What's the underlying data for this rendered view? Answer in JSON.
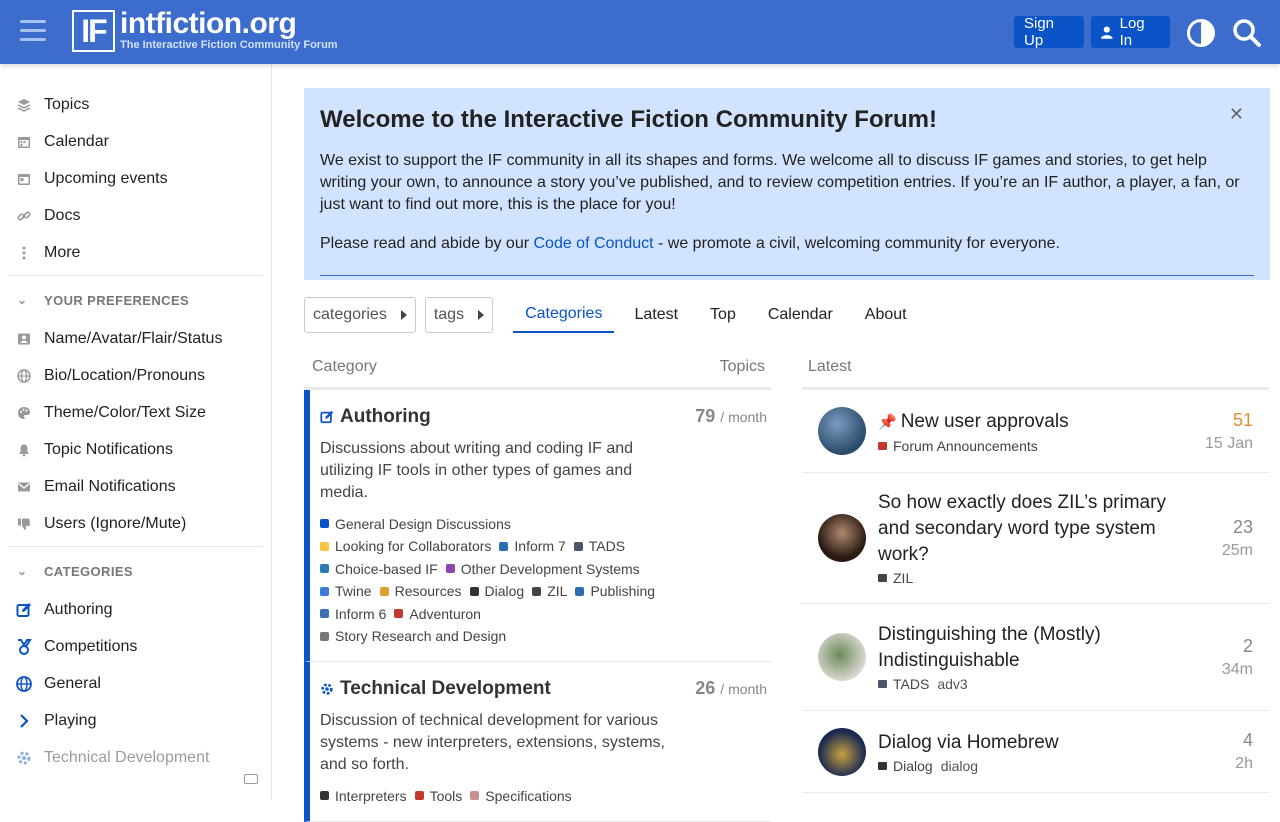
{
  "header": {
    "logo_mark": "IF",
    "logo_title": "intfiction.org",
    "logo_subtitle": "The Interactive Fiction Community Forum",
    "signup_label": "Sign Up",
    "login_label": "Log In"
  },
  "sidebar": {
    "top_items": [
      {
        "label": "Topics",
        "icon": "layers-icon"
      },
      {
        "label": "Calendar",
        "icon": "calendar-icon"
      },
      {
        "label": "Upcoming events",
        "icon": "calendar-day-icon"
      },
      {
        "label": "Docs",
        "icon": "link-icon"
      },
      {
        "label": "More",
        "icon": "ellipsis-icon"
      }
    ],
    "prefs_header": "YOUR PREFERENCES",
    "prefs_items": [
      {
        "label": "Name/Avatar/Flair/Status",
        "icon": "id-card-icon"
      },
      {
        "label": "Bio/Location/Pronouns",
        "icon": "globe-icon"
      },
      {
        "label": "Theme/Color/Text Size",
        "icon": "palette-icon"
      },
      {
        "label": "Topic Notifications",
        "icon": "bell-icon"
      },
      {
        "label": "Email Notifications",
        "icon": "envelope-icon"
      },
      {
        "label": "Users (Ignore/Mute)",
        "icon": "thumbs-down-icon"
      }
    ],
    "categories_header": "CATEGORIES",
    "category_items": [
      {
        "label": "Authoring",
        "icon": "edit-icon"
      },
      {
        "label": "Competitions",
        "icon": "medal-icon"
      },
      {
        "label": "General",
        "icon": "globe-icon"
      },
      {
        "label": "Playing",
        "icon": "chevron-right-icon"
      },
      {
        "label": "Technical Development",
        "icon": "gear-icon"
      }
    ]
  },
  "banner": {
    "title": "Welcome to the Interactive Fiction Community Forum!",
    "paragraph": "We exist to support the IF community in all its shapes and forms. We welcome all to discuss IF games and stories, to get help writing your own, to announce a story you’ve published, and to review competition entries. If you’re an IF author, a player, a fan, or just want to find out more, this is the place for you!",
    "conduct_prefix": "Please read and abide by our ",
    "conduct_link": "Code of Conduct",
    "conduct_suffix": " - we promote a civil, welcoming community for everyone."
  },
  "nav": {
    "categories_dropdown": "categories",
    "tags_dropdown": "tags",
    "tabs": [
      "Categories",
      "Latest",
      "Top",
      "Calendar",
      "About"
    ],
    "active_tab": "Categories"
  },
  "categories_table": {
    "col_category": "Category",
    "col_topics": "Topics",
    "rows": [
      {
        "name": "Authoring",
        "count": "79",
        "period": "/ month",
        "description": "Discussions about writing and coding IF and utilizing IF tools in other types of games and media.",
        "subcategories": [
          {
            "label": "General Design Discussions",
            "color": "#0a54c7"
          },
          {
            "label": "Looking for Collaborators",
            "color": "#f5c542"
          },
          {
            "label": "Inform 7",
            "color": "#2a6fb0"
          },
          {
            "label": "TADS",
            "color": "#4a5568"
          },
          {
            "label": "Choice-based IF",
            "color": "#2b7bb9"
          },
          {
            "label": "Other Development Systems",
            "color": "#8e44ad"
          },
          {
            "label": "Twine",
            "color": "#3a7bd5"
          },
          {
            "label": "Resources",
            "color": "#e0a030"
          },
          {
            "label": "Dialog",
            "color": "#333333"
          },
          {
            "label": "ZIL",
            "color": "#444444"
          },
          {
            "label": "Publishing",
            "color": "#2a6fb0"
          },
          {
            "label": "Inform 6",
            "color": "#3a6fb0"
          },
          {
            "label": "Adventuron",
            "color": "#c0392b"
          },
          {
            "label": "Story Research and Design",
            "color": "#777777"
          }
        ]
      },
      {
        "name": "Technical Development",
        "count": "26",
        "period": "/ month",
        "description": "Discussion of technical development for various systems - new interpreters, extensions, systems, and so forth.",
        "subcategories": [
          {
            "label": "Interpreters",
            "color": "#333333"
          },
          {
            "label": "Tools",
            "color": "#c0392b"
          },
          {
            "label": "Specifications",
            "color": "#c98f8f"
          }
        ]
      }
    ]
  },
  "latest": {
    "header": "Latest",
    "topics": [
      {
        "title": "New user approvals",
        "category": "Forum Announcements",
        "tag": "",
        "count": "51",
        "time": "15 Jan",
        "pinned": true
      },
      {
        "title": "So how exactly does ZIL’s primary and secondary word type system work?",
        "category": "ZIL",
        "tag": "",
        "count": "23",
        "time": "25m",
        "pinned": false
      },
      {
        "title": "Distinguishing the (Mostly) Indistinguishable",
        "category": "TADS",
        "tag": "adv3",
        "count": "2",
        "time": "34m",
        "pinned": false
      },
      {
        "title": "Dialog via Homebrew",
        "category": "Dialog",
        "tag": "dialog",
        "count": "4",
        "time": "2h",
        "pinned": false
      }
    ]
  },
  "colors": {
    "header_bg": "#3d6dcc",
    "accent": "#0a54c7",
    "banner_bg": "#d1e3ff",
    "hot_count": "#e38d34"
  }
}
